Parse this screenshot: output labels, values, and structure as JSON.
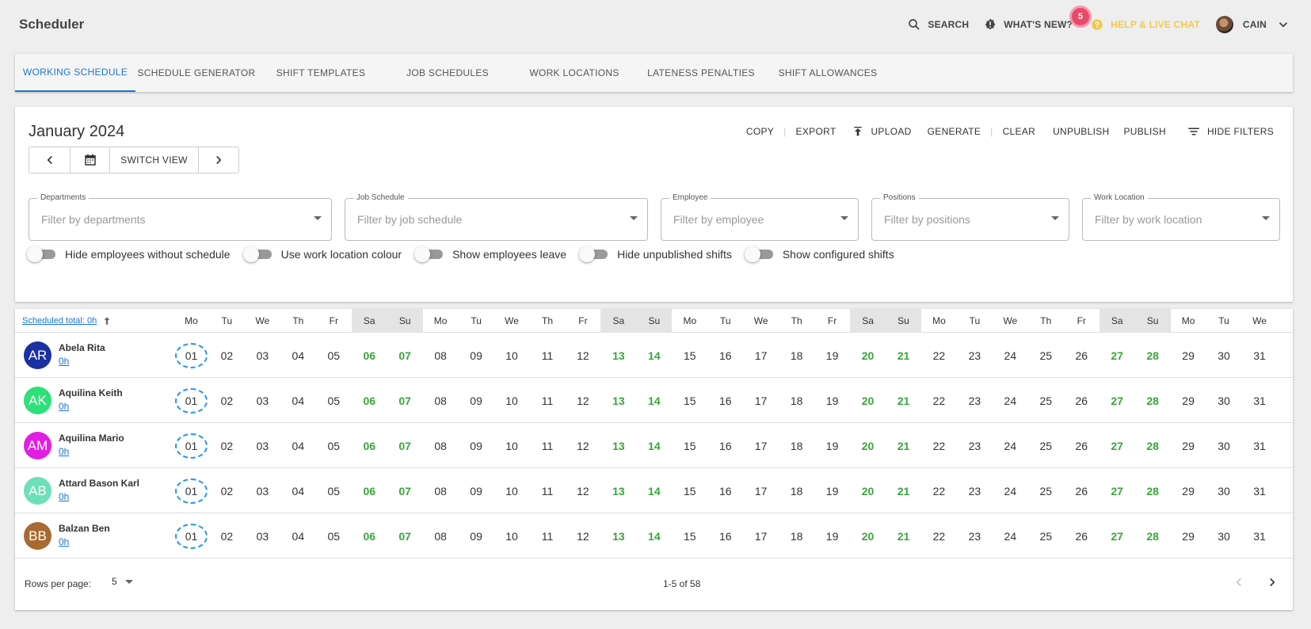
{
  "app": {
    "title": "Scheduler"
  },
  "topbar": {
    "search": "SEARCH",
    "whats_new": "WHAT'S NEW?",
    "whats_new_badge": "5",
    "help": "HELP & LIVE CHAT",
    "user": "CAIN"
  },
  "tabs": [
    {
      "label": "WORKING SCHEDULE"
    },
    {
      "label": "SCHEDULE GENERATOR"
    },
    {
      "label": "SHIFT TEMPLATES"
    },
    {
      "label": "JOB SCHEDULES"
    },
    {
      "label": "WORK LOCATIONS"
    },
    {
      "label": "LATENESS PENALTIES"
    },
    {
      "label": "SHIFT ALLOWANCES"
    }
  ],
  "schedule": {
    "month_title": "January 2024",
    "switch_view": "SWITCH VIEW",
    "actions": {
      "copy": "COPY",
      "export": "EXPORT",
      "upload": "UPLOAD",
      "generate": "GENERATE",
      "clear": "CLEAR",
      "unpublish": "UNPUBLISH",
      "publish": "PUBLISH",
      "hide_filters": "HIDE FILTERS"
    },
    "filters": [
      {
        "label": "Departments",
        "placeholder": "Filter by departments"
      },
      {
        "label": "Job Schedule",
        "placeholder": "Filter by job schedule"
      },
      {
        "label": "Employee",
        "placeholder": "Filter by employee"
      },
      {
        "label": "Positions",
        "placeholder": "Filter by positions"
      },
      {
        "label": "Work Location",
        "placeholder": "Filter by work location"
      }
    ],
    "toggles": [
      {
        "label": "Hide employees without schedule"
      },
      {
        "label": "Use work location colour"
      },
      {
        "label": "Show employees leave"
      },
      {
        "label": "Hide unpublished shifts"
      },
      {
        "label": "Show configured shifts"
      }
    ]
  },
  "table": {
    "scheduled_total": "Scheduled total: 0h",
    "weekdays": [
      "Mo",
      "Tu",
      "We",
      "Th",
      "Fr",
      "Sa",
      "Su",
      "Mo",
      "Tu",
      "We",
      "Th",
      "Fr",
      "Sa",
      "Su",
      "Mo",
      "Tu",
      "We",
      "Th",
      "Fr",
      "Sa",
      "Su",
      "Mo",
      "Tu",
      "We",
      "Th",
      "Fr",
      "Sa",
      "Su",
      "Mo",
      "Tu",
      "We"
    ],
    "days": [
      "01",
      "02",
      "03",
      "04",
      "05",
      "06",
      "07",
      "08",
      "09",
      "10",
      "11",
      "12",
      "13",
      "14",
      "15",
      "16",
      "17",
      "18",
      "19",
      "20",
      "21",
      "22",
      "23",
      "24",
      "25",
      "26",
      "27",
      "28",
      "29",
      "30",
      "31"
    ],
    "employees": [
      {
        "initials": "AR",
        "name": "Abela Rita",
        "hours": "0h",
        "color": "#1a2fa0"
      },
      {
        "initials": "AK",
        "name": "Aquilina Keith",
        "hours": "0h",
        "color": "#2ee07a"
      },
      {
        "initials": "AM",
        "name": "Aquilina Mario",
        "hours": "0h",
        "color": "#e21ee2"
      },
      {
        "initials": "AB",
        "name": "Attard Bason Karl",
        "hours": "0h",
        "color": "#6ee0b8"
      },
      {
        "initials": "BB",
        "name": "Balzan Ben",
        "hours": "0h",
        "color": "#a86a30"
      }
    ],
    "rows_per_page_label": "Rows per page:",
    "rows_per_page": "5",
    "range": "1-5 of 58"
  }
}
